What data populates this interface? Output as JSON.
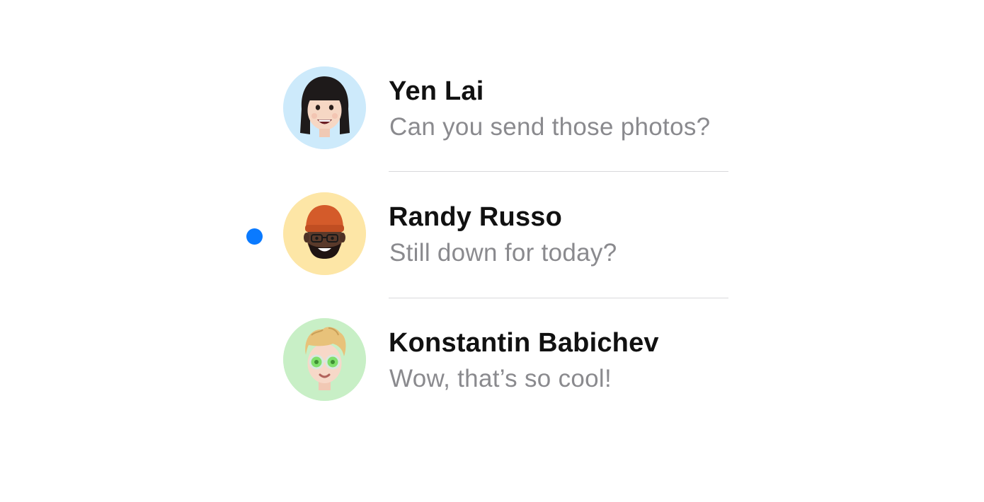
{
  "conversations": [
    {
      "name": "Yen Lai",
      "preview": "Can you send those photos?",
      "unread": false,
      "avatar": {
        "icon": "memoji-woman-bangs-icon",
        "background": "#cdeafb"
      }
    },
    {
      "name": "Randy Russo",
      "preview": "Still down for today?",
      "unread": true,
      "avatar": {
        "icon": "memoji-man-beanie-icon",
        "background": "#fde6a6"
      }
    },
    {
      "name": "Konstantin Babichev",
      "preview": "Wow, that’s so cool!",
      "unread": false,
      "avatar": {
        "icon": "memoji-man-sunglasses-icon",
        "background": "#c8efc6"
      }
    }
  ],
  "colors": {
    "unread_dot": "#0a7aff",
    "name_text": "#111111",
    "preview_text": "#8a8a8e",
    "divider": "#d9d9dc"
  }
}
